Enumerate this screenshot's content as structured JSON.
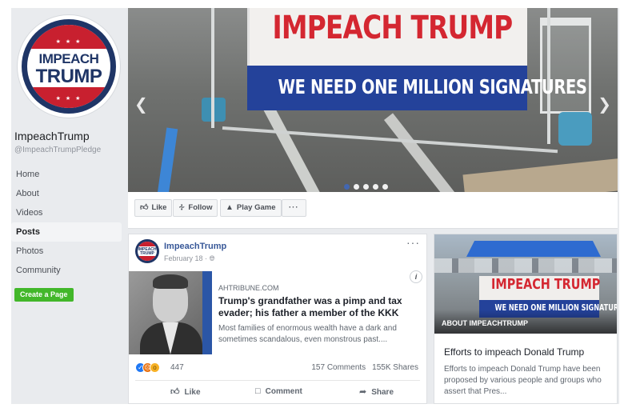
{
  "page": {
    "name": "ImpeachTrump",
    "handle": "@ImpeachTrumpPledge",
    "logo": {
      "line1": "IMPEACH",
      "line2": "TRUMP",
      "stars": "★ ★ ★"
    }
  },
  "sidebar": {
    "items": [
      {
        "label": "Home",
        "active": false
      },
      {
        "label": "About",
        "active": false
      },
      {
        "label": "Videos",
        "active": false
      },
      {
        "label": "Posts",
        "active": true
      },
      {
        "label": "Photos",
        "active": false
      },
      {
        "label": "Community",
        "active": false
      }
    ],
    "create_page_label": "Create a Page"
  },
  "cover": {
    "banner_top": "IMPEACH TRUMP",
    "banner_bottom": "WE NEED ONE MILLION SIGNATURES",
    "prev_icon": "chevron-left-icon",
    "next_icon": "chevron-right-icon",
    "slide_count": 5,
    "active_slide": 1
  },
  "actions": {
    "like": "Like",
    "follow": "Follow",
    "play_game": "Play Game",
    "more": "···"
  },
  "post": {
    "author": "ImpeachTrump",
    "date": "February 18 · ",
    "audience_icon": "globe-icon",
    "more": "···",
    "link": {
      "domain": "AHTRIBUNE.COM",
      "title": "Trump's grandfather was a pimp and tax evader; his father a member of the KKK",
      "description": "Most families of enormous wealth have a dark and sometimes scandalous, even monstrous past...."
    },
    "reactions": {
      "count": "447",
      "types": [
        "like",
        "angry",
        "wow"
      ]
    },
    "comments": "157 Comments",
    "shares": "155K Shares",
    "like_label": "Like",
    "comment_label": "Comment",
    "share_label": "Share"
  },
  "about": {
    "image_label": "ABOUT IMPEACHTRUMP",
    "banner_top": "IMPEACH TRUMP",
    "banner_bottom": "WE NEED ONE MILLION SIGNATURES",
    "title": "Efforts to impeach Donald Trump",
    "description": "Efforts to impeach Donald Trump have been proposed by various people and groups who assert that Pres..."
  },
  "colors": {
    "facebook_blue": "#4267b2",
    "link_blue": "#385898",
    "green": "#42b72a",
    "banner_red": "#d42731",
    "banner_blue": "#24429a"
  }
}
